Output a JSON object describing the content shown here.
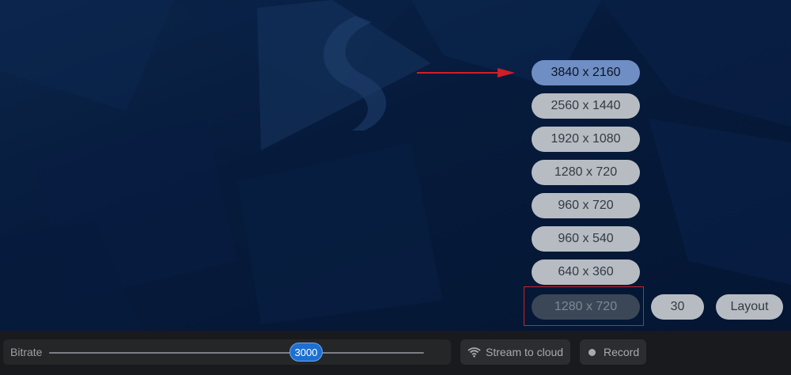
{
  "resolution_menu": {
    "options": [
      "3840 x 2160",
      "2560 x 1440",
      "1920 x 1080",
      "1280 x 720",
      "960 x 720",
      "960 x 540",
      "640 x 360"
    ],
    "selected_index": 0,
    "current_value": "1280 x 720"
  },
  "fps_button": {
    "label": "30"
  },
  "layout_button": {
    "label": "Layout"
  },
  "controls": {
    "bitrate_label": "Bitrate",
    "bitrate_value": "3000",
    "stream_label": "Stream to cloud",
    "record_label": "Record"
  },
  "colors": {
    "background": "#051a3a",
    "selected_option": "#6f8ec4",
    "option": "#b7bcc3",
    "annotation_red": "#c8232c",
    "slider_accent": "#1f6fd1"
  },
  "icons": [
    "wifi-icon",
    "record-dot-icon",
    "arrow-annotation"
  ]
}
